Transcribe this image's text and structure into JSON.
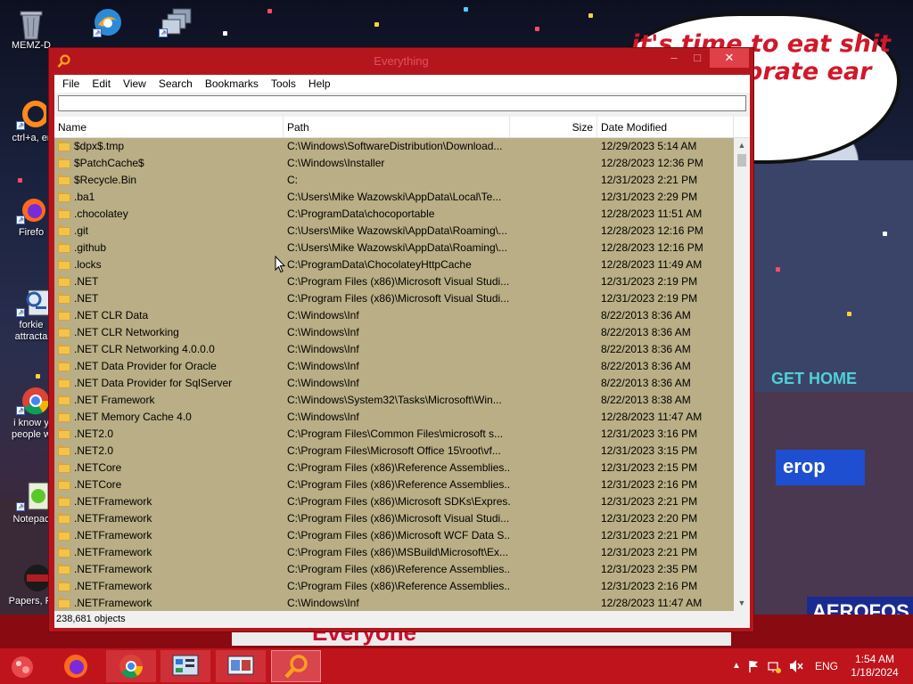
{
  "desktop": {
    "wallpaper_text": "it's time to eat shit and celebrate ear",
    "sign_text_1": "GET HOME",
    "sign_text_2": "erop",
    "sign_text_3": "AEROFOS",
    "strip_text": "Everyone",
    "icons": [
      {
        "label": "MEMZ-D",
        "icon": "recycle-bin-icon"
      },
      {
        "label": "ctrl+a, er",
        "icon": "shortcut-icon"
      },
      {
        "label": "Firefo",
        "icon": "firefox-icon"
      },
      {
        "label": "forkie attracta",
        "icon": "settings-app-icon"
      },
      {
        "label": "i know y people w",
        "icon": "chrome-icon"
      },
      {
        "label": "Notepac",
        "icon": "notepad-icon"
      },
      {
        "label": "Papers, Pl",
        "icon": "game-icon"
      }
    ]
  },
  "window": {
    "title": "Everything",
    "minimize": "–",
    "maximize": "□",
    "close": "✕",
    "menu": [
      "File",
      "Edit",
      "View",
      "Search",
      "Bookmarks",
      "Tools",
      "Help"
    ],
    "search": {
      "value": "",
      "placeholder": ""
    },
    "columns": {
      "name": "Name",
      "path": "Path",
      "size": "Size",
      "date": "Date Modified"
    },
    "rows": [
      {
        "name": "$dpx$.tmp",
        "path": "C:\\Windows\\SoftwareDistribution\\Download...",
        "size": "",
        "date": "12/29/2023 5:14 AM"
      },
      {
        "name": "$PatchCache$",
        "path": "C:\\Windows\\Installer",
        "size": "",
        "date": "12/28/2023 12:36 PM"
      },
      {
        "name": "$Recycle.Bin",
        "path": "C:",
        "size": "",
        "date": "12/31/2023 2:21 PM"
      },
      {
        "name": ".ba1",
        "path": "C:\\Users\\Mike Wazowski\\AppData\\Local\\Te...",
        "size": "",
        "date": "12/31/2023 2:29 PM"
      },
      {
        "name": ".chocolatey",
        "path": "C:\\ProgramData\\chocoportable",
        "size": "",
        "date": "12/28/2023 11:51 AM"
      },
      {
        "name": ".git",
        "path": "C:\\Users\\Mike Wazowski\\AppData\\Roaming\\...",
        "size": "",
        "date": "12/28/2023 12:16 PM"
      },
      {
        "name": ".github",
        "path": "C:\\Users\\Mike Wazowski\\AppData\\Roaming\\...",
        "size": "",
        "date": "12/28/2023 12:16 PM"
      },
      {
        "name": ".locks",
        "path": "C:\\ProgramData\\ChocolateyHttpCache",
        "size": "",
        "date": "12/28/2023 11:49 AM"
      },
      {
        "name": ".NET",
        "path": "C:\\Program Files (x86)\\Microsoft Visual Studi...",
        "size": "",
        "date": "12/31/2023 2:19 PM"
      },
      {
        "name": ".NET",
        "path": "C:\\Program Files (x86)\\Microsoft Visual Studi...",
        "size": "",
        "date": "12/31/2023 2:19 PM"
      },
      {
        "name": ".NET CLR Data",
        "path": "C:\\Windows\\Inf",
        "size": "",
        "date": "8/22/2013 8:36 AM"
      },
      {
        "name": ".NET CLR Networking",
        "path": "C:\\Windows\\Inf",
        "size": "",
        "date": "8/22/2013 8:36 AM"
      },
      {
        "name": ".NET CLR Networking 4.0.0.0",
        "path": "C:\\Windows\\Inf",
        "size": "",
        "date": "8/22/2013 8:36 AM"
      },
      {
        "name": ".NET Data Provider for Oracle",
        "path": "C:\\Windows\\Inf",
        "size": "",
        "date": "8/22/2013 8:36 AM"
      },
      {
        "name": ".NET Data Provider for SqlServer",
        "path": "C:\\Windows\\Inf",
        "size": "",
        "date": "8/22/2013 8:36 AM"
      },
      {
        "name": ".NET Framework",
        "path": "C:\\Windows\\System32\\Tasks\\Microsoft\\Win...",
        "size": "",
        "date": "8/22/2013 8:38 AM"
      },
      {
        "name": ".NET Memory Cache 4.0",
        "path": "C:\\Windows\\Inf",
        "size": "",
        "date": "12/28/2023 11:47 AM"
      },
      {
        "name": ".NET2.0",
        "path": "C:\\Program Files\\Common Files\\microsoft s...",
        "size": "",
        "date": "12/31/2023 3:16 PM"
      },
      {
        "name": ".NET2.0",
        "path": "C:\\Program Files\\Microsoft Office 15\\root\\vf...",
        "size": "",
        "date": "12/31/2023 3:15 PM"
      },
      {
        "name": ".NETCore",
        "path": "C:\\Program Files (x86)\\Reference Assemblies...",
        "size": "",
        "date": "12/31/2023 2:15 PM"
      },
      {
        "name": ".NETCore",
        "path": "C:\\Program Files (x86)\\Reference Assemblies...",
        "size": "",
        "date": "12/31/2023 2:16 PM"
      },
      {
        "name": ".NETFramework",
        "path": "C:\\Program Files (x86)\\Microsoft SDKs\\Expres...",
        "size": "",
        "date": "12/31/2023 2:21 PM"
      },
      {
        "name": ".NETFramework",
        "path": "C:\\Program Files (x86)\\Microsoft Visual Studi...",
        "size": "",
        "date": "12/31/2023 2:20 PM"
      },
      {
        "name": ".NETFramework",
        "path": "C:\\Program Files (x86)\\Microsoft WCF Data S...",
        "size": "",
        "date": "12/31/2023 2:21 PM"
      },
      {
        "name": ".NETFramework",
        "path": "C:\\Program Files (x86)\\MSBuild\\Microsoft\\Ex...",
        "size": "",
        "date": "12/31/2023 2:21 PM"
      },
      {
        "name": ".NETFramework",
        "path": "C:\\Program Files (x86)\\Reference Assemblies...",
        "size": "",
        "date": "12/31/2023 2:35 PM"
      },
      {
        "name": ".NETFramework",
        "path": "C:\\Program Files (x86)\\Reference Assemblies...",
        "size": "",
        "date": "12/31/2023 2:16 PM"
      },
      {
        "name": ".NETFramework",
        "path": "C:\\Windows\\Inf",
        "size": "",
        "date": "12/28/2023 11:47 AM"
      }
    ],
    "status": "238,681 objects"
  },
  "taskbar": {
    "items": [
      "start-orb-icon",
      "firefox-icon",
      "chrome-icon",
      "control-panel-icon",
      "window-switcher-icon",
      "everything-search-icon"
    ],
    "language": "ENG",
    "time": "1:54 AM",
    "date": "1/18/2024"
  },
  "colors": {
    "window_frame": "#b5161e",
    "list_background": "#b9ae85",
    "taskbar": "#c0141c"
  }
}
